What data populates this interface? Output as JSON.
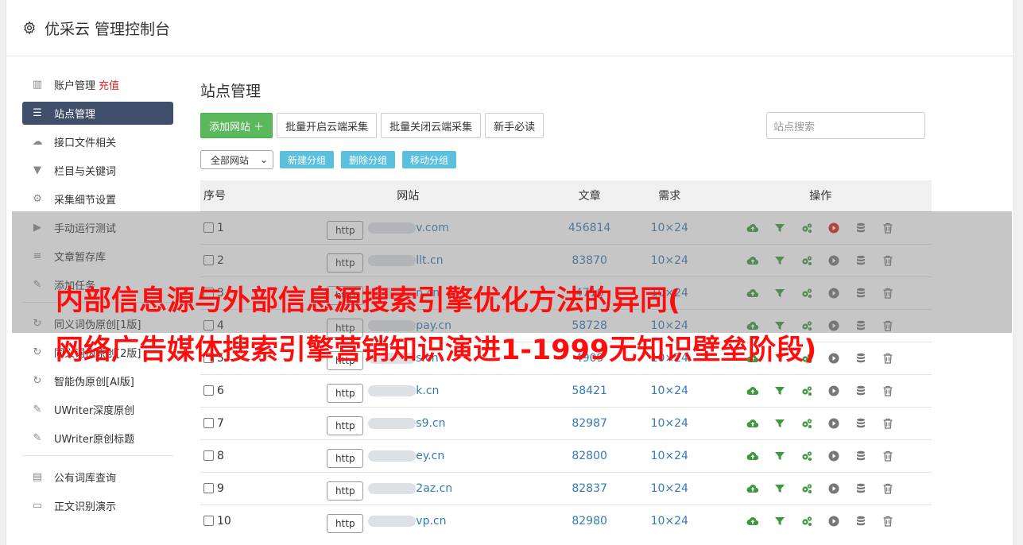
{
  "header": {
    "title": "优采云 管理控制台"
  },
  "sidebar": {
    "items": [
      {
        "label": "账户管理",
        "extra": "充值",
        "icon": "bar-chart-icon"
      },
      {
        "label": "站点管理",
        "icon": "server-icon",
        "active": true
      },
      {
        "label": "接口文件相关",
        "icon": "cloud-upload-icon"
      },
      {
        "label": "栏目与关键词",
        "icon": "filter-icon"
      },
      {
        "label": "采集细节设置",
        "icon": "gears-icon"
      },
      {
        "label": "手动运行测试",
        "icon": "play-icon"
      },
      {
        "label": "文章暂存库",
        "icon": "database-icon"
      },
      {
        "label": "添加任务",
        "icon": "edit-icon"
      },
      {
        "label": "同义词伪原创[1版]",
        "icon": "refresh-icon"
      },
      {
        "label": "同义词伪原创[2版]",
        "icon": "refresh-icon"
      },
      {
        "label": "智能伪原创[AI版]",
        "icon": "refresh-icon"
      },
      {
        "label": "UWriter深度原创",
        "icon": "edit-icon"
      },
      {
        "label": "UWriter原创标题",
        "icon": "edit-icon"
      },
      {
        "label": "公有词库查询",
        "icon": "book-icon"
      },
      {
        "label": "正文识别演示",
        "icon": "monitor-icon"
      }
    ]
  },
  "main": {
    "title": "站点管理",
    "toolbar": {
      "add_site": "添加网站 ＋",
      "batch_open": "批量开启云端采集",
      "batch_close": "批量关闭云端采集",
      "guide": "新手必读",
      "search_placeholder": "站点搜索"
    },
    "group": {
      "select_value": "全部网站",
      "new_group": "新建分组",
      "delete_group": "删除分组",
      "move_group": "移动分组"
    },
    "table": {
      "headers": {
        "no": "序号",
        "site": "网站",
        "articles": "文章",
        "demand": "需求",
        "ops": "操作"
      },
      "rows": [
        {
          "no": "1",
          "proto": "http",
          "site": "v.com",
          "articles": "456814",
          "demand": "10×24",
          "running": true
        },
        {
          "no": "2",
          "proto": "http",
          "site": "llt.cn",
          "articles": "83870",
          "demand": "10×24"
        },
        {
          "no": "3",
          "proto": "http",
          "site": "n.cn",
          "articles": "4716",
          "demand": "10×24"
        },
        {
          "no": "4",
          "proto": "http",
          "site": "pay.cn",
          "articles": "58728",
          "demand": "10×24"
        },
        {
          "no": "5",
          "proto": "http",
          "site": "s.cn",
          "articles": "4909",
          "demand": "10×24"
        },
        {
          "no": "6",
          "proto": "http",
          "site": "k.cn",
          "articles": "58421",
          "demand": "10×24"
        },
        {
          "no": "7",
          "proto": "http",
          "site": "s9.cn",
          "articles": "82987",
          "demand": "10×24"
        },
        {
          "no": "8",
          "proto": "http",
          "site": "ey.cn",
          "articles": "82800",
          "demand": "10×24"
        },
        {
          "no": "9",
          "proto": "http",
          "site": "2az.cn",
          "articles": "82837",
          "demand": "10×24"
        },
        {
          "no": "10",
          "proto": "http",
          "site": "vp.cn",
          "articles": "82980",
          "demand": "10×24"
        }
      ]
    }
  },
  "overlay": {
    "line1": "内部信息源与外部信息源搜索引擎优化方法的异同(",
    "line2": "网络广告媒体搜索引擎营销知识演进1-1999无知识壁垒阶段)"
  },
  "colors": {
    "accent": "#3f4f6b",
    "green": "#5cb85c",
    "info": "#5bc0de",
    "link": "#337ab7",
    "overlay_text": "#ff0d0d"
  }
}
